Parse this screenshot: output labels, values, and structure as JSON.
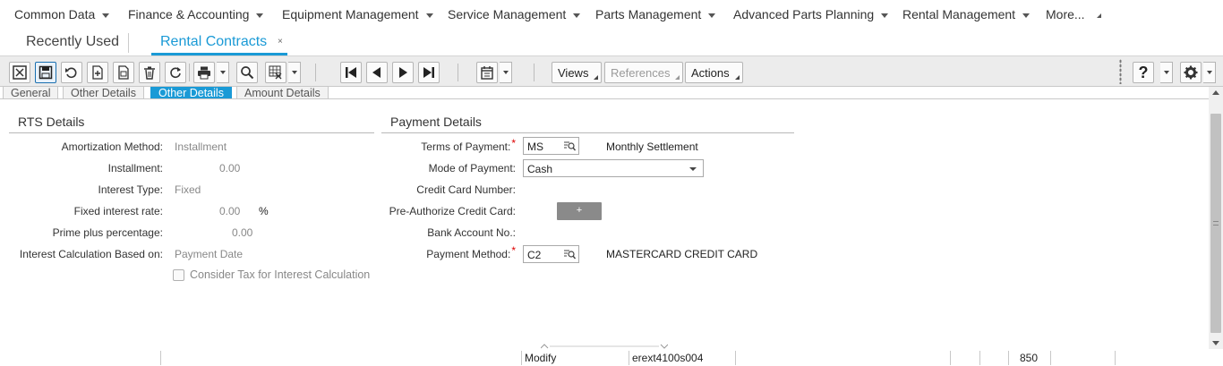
{
  "top_menu": {
    "items": [
      {
        "label": "Common Data"
      },
      {
        "label": "Finance & Accounting"
      },
      {
        "label": "Equipment Management"
      },
      {
        "label": "Service Management"
      },
      {
        "label": "Parts Management"
      },
      {
        "label": "Advanced Parts Planning"
      },
      {
        "label": "Rental Management"
      },
      {
        "label": "More..."
      }
    ]
  },
  "tabs": {
    "recent": "Recently Used",
    "active": "Rental Contracts",
    "close_glyph": "×"
  },
  "toolbar": {
    "views": "Views",
    "references": "References",
    "actions": "Actions",
    "help": "?"
  },
  "subtabs": [
    "General",
    "Other Details",
    "Other Details",
    "Amount Details"
  ],
  "rts": {
    "title": "RTS Details",
    "fields": [
      {
        "label": "Amortization Method:",
        "value": "Installment"
      },
      {
        "label": "Installment:",
        "value": "0.00"
      },
      {
        "label": "Interest Type:",
        "value": "Fixed"
      },
      {
        "label": "Fixed interest rate:",
        "value": "0.00",
        "unit": "%"
      },
      {
        "label": "Prime plus percentage:",
        "value": "0.00"
      },
      {
        "label": "Interest Calculation Based on:",
        "value": "Payment Date"
      }
    ],
    "checkbox_label": "Consider Tax for Interest Calculation"
  },
  "payment": {
    "title": "Payment Details",
    "terms_label": "Terms of Payment:",
    "terms_value": "MS",
    "terms_desc": "Monthly Settlement",
    "mode_label": "Mode of Payment:",
    "mode_value": "Cash",
    "cc_number_label": "Credit Card Number:",
    "preauth_label": "Pre-Authorize Credit Card:",
    "preauth_button": "+",
    "bank_label": "Bank Account No.:",
    "method_label": "Payment Method:",
    "method_value": "C2",
    "method_desc": "MASTERCARD CREDIT CARD",
    "required_mark": "*"
  },
  "status": {
    "mode": "Modify",
    "screen": "erext4100s004",
    "number": "850"
  },
  "colors": {
    "accent": "#1a9ad6",
    "required": "#dd0000"
  }
}
